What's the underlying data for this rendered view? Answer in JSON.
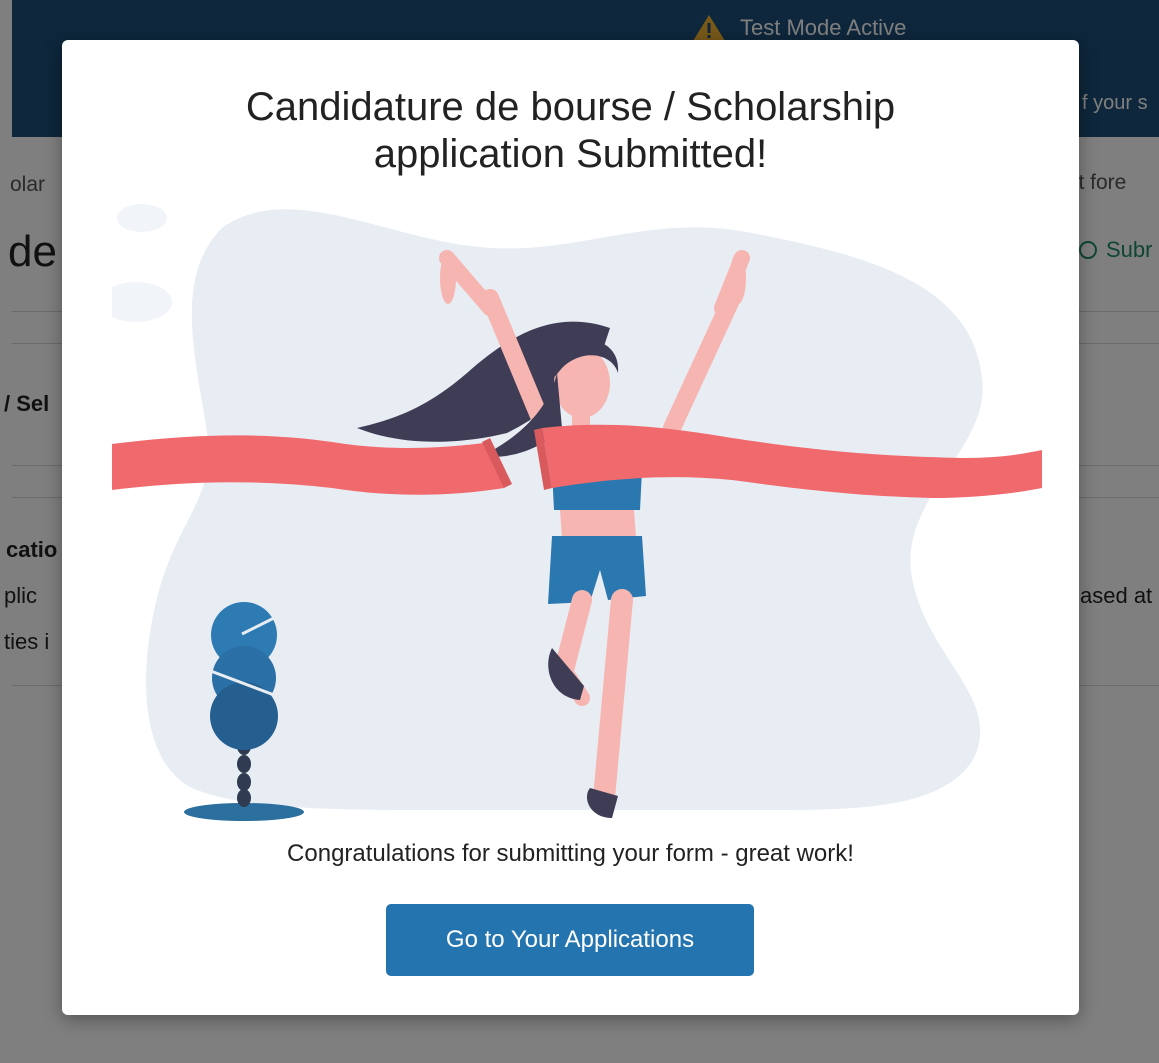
{
  "topbar": {
    "test_mode": "Test Mode Active",
    "right_text": "f your s",
    "warning_icon": "warning-triangle-icon"
  },
  "page": {
    "breadcrumb_left": "olar",
    "breadcrumb_right": "ct fore",
    "title_fragment": "de",
    "status_fragment": "Subr",
    "status_icon": "clock-icon",
    "section_selection": "/ Sel",
    "section_application": "catio",
    "line_applic": "plic",
    "line_ties": "ties i",
    "line_based": "ased at"
  },
  "modal": {
    "title_line1": "Candidature de bourse / Scholarship",
    "title_line2": "application Submitted!",
    "message": "Congratulations for submitting your form - great work!",
    "button_label": "Go to Your Applications",
    "illustration": "runner-finish-line-illustration"
  },
  "colors": {
    "topbar_bg": "#1d4f78",
    "primary": "#2474b0",
    "ribbon": "#f0696c",
    "blob": "#e8edf4",
    "skin": "#f7b5b1",
    "hair": "#3f3d56",
    "outfit": "#2b77b0"
  }
}
